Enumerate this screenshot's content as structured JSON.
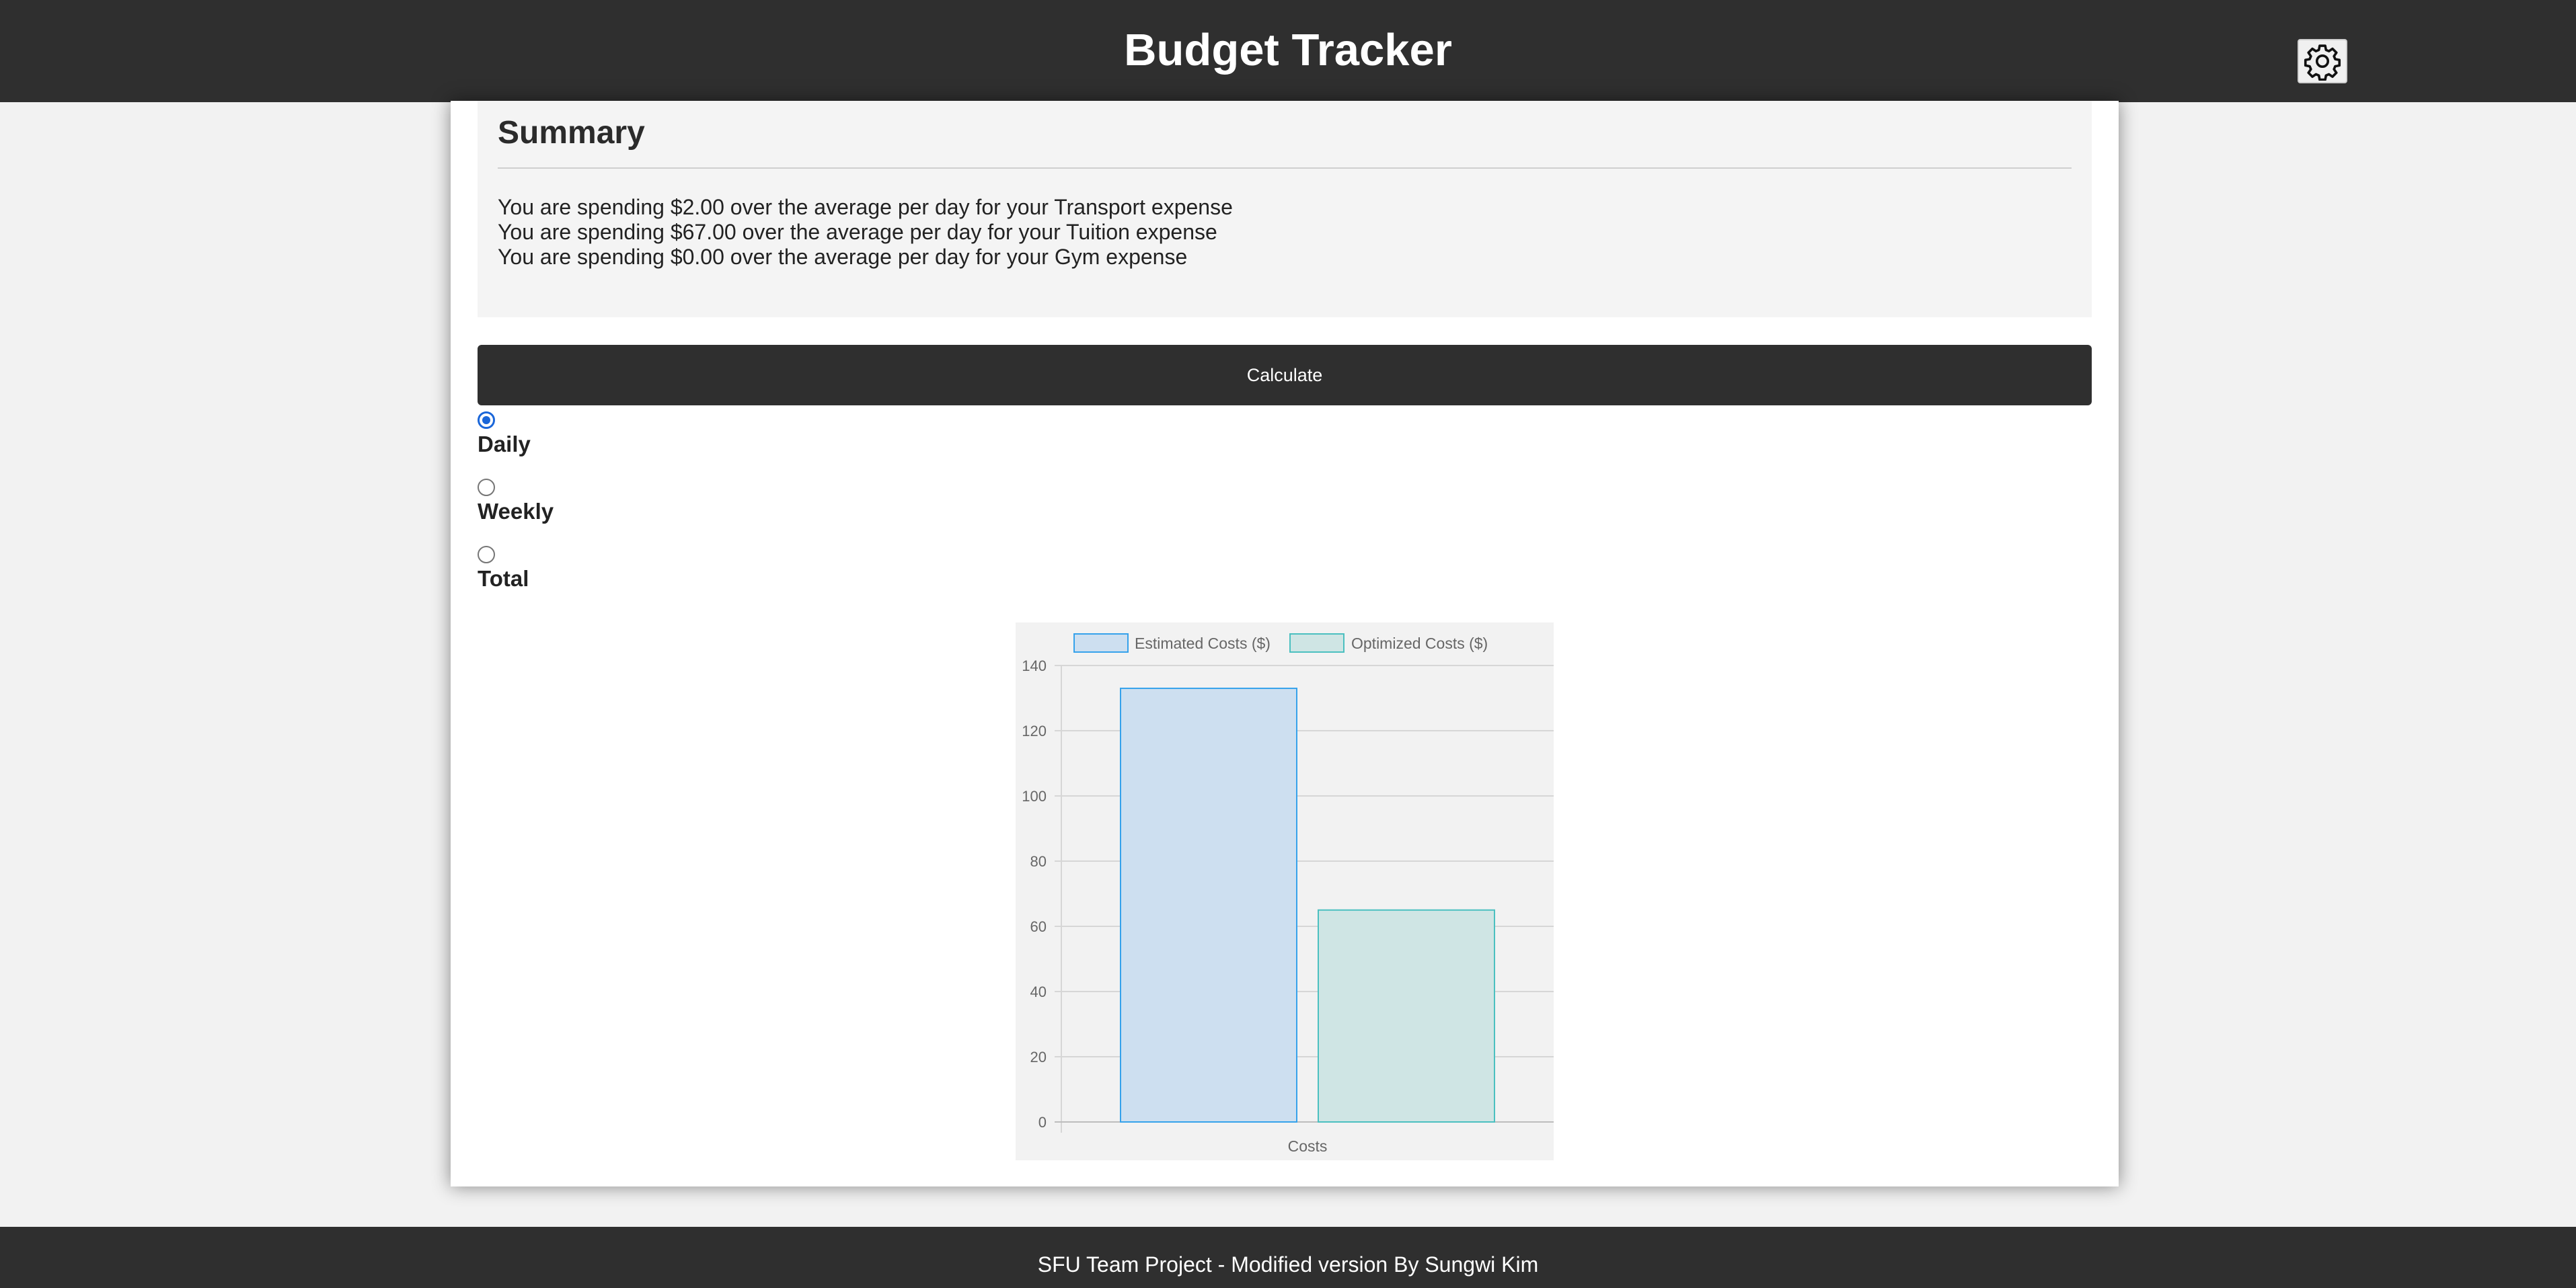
{
  "header": {
    "title": "Budget Tracker",
    "settings_icon": "gear-icon"
  },
  "summary": {
    "title": "Summary",
    "lines": [
      "You are spending $2.00 over the average per day for your Transport expense",
      "You are spending $67.00 over the average per day for your Tuition expense",
      "You are spending $0.00 over the average per day for your Gym expense"
    ]
  },
  "calculate": {
    "label": "Calculate"
  },
  "period": {
    "options": [
      {
        "label": "Daily",
        "checked": true
      },
      {
        "label": "Weekly",
        "checked": false
      },
      {
        "label": "Total",
        "checked": false
      }
    ]
  },
  "chart_data": {
    "type": "bar",
    "categories": [
      "Costs"
    ],
    "series": [
      {
        "name": "Estimated Costs ($)",
        "values": [
          133
        ],
        "fill": "#cddff0",
        "stroke": "#36a2eb"
      },
      {
        "name": "Optimized Costs ($)",
        "values": [
          65
        ],
        "fill": "#cfe5e4",
        "stroke": "#4bc0c0"
      }
    ],
    "xlabel": "",
    "ylabel": "",
    "ylim": [
      0,
      140
    ],
    "yticks": [
      0,
      20,
      40,
      60,
      80,
      100,
      120,
      140
    ],
    "grid": true,
    "legend": "top"
  },
  "footer": {
    "text": "SFU Team Project - Modified version By Sungwi Kim"
  }
}
